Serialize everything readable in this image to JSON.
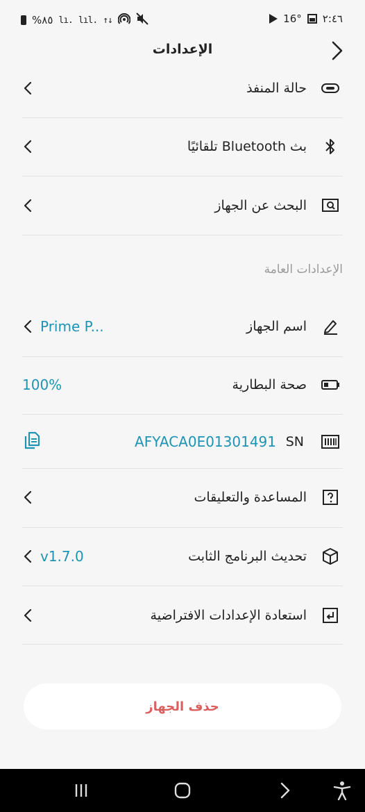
{
  "status_bar": {
    "battery": "%٨٥",
    "signal_1": "lı.",
    "signal_2": "lıl.",
    "data_icon": "↑↓",
    "hotspot_icon": "hotspot-icon",
    "mute_icon": "mute-icon",
    "temperature": "16°",
    "time": "٢:٤٦"
  },
  "header": {
    "title": "الإعدادات"
  },
  "rows_top": [
    {
      "label": "حالة المنفذ",
      "icon": "toggle-icon"
    },
    {
      "label": "بث Bluetooth تلقائيًا",
      "icon": "bluetooth-icon"
    },
    {
      "label": "البحث عن الجهاز",
      "icon": "device-search-icon"
    }
  ],
  "general_section": {
    "title": "الإعدادات العامة",
    "device_name": {
      "label": "اسم الجهاز",
      "value": "Prime P..."
    },
    "battery_health": {
      "label": "صحة البطارية",
      "value": "100%"
    },
    "serial": {
      "label": "SN",
      "value": "AFYACA0E01301491"
    },
    "help": {
      "label": "المساعدة والتعليقات"
    },
    "firmware": {
      "label": "تحديث البرنامج الثابت",
      "value": "v1.7.0"
    },
    "reset": {
      "label": "استعادة الإعدادات الافتراضية"
    }
  },
  "delete_button": "حذف الجهاز",
  "colors": {
    "accent": "#1f93b3",
    "danger": "#d9605e",
    "background": "#f6f6f6"
  }
}
